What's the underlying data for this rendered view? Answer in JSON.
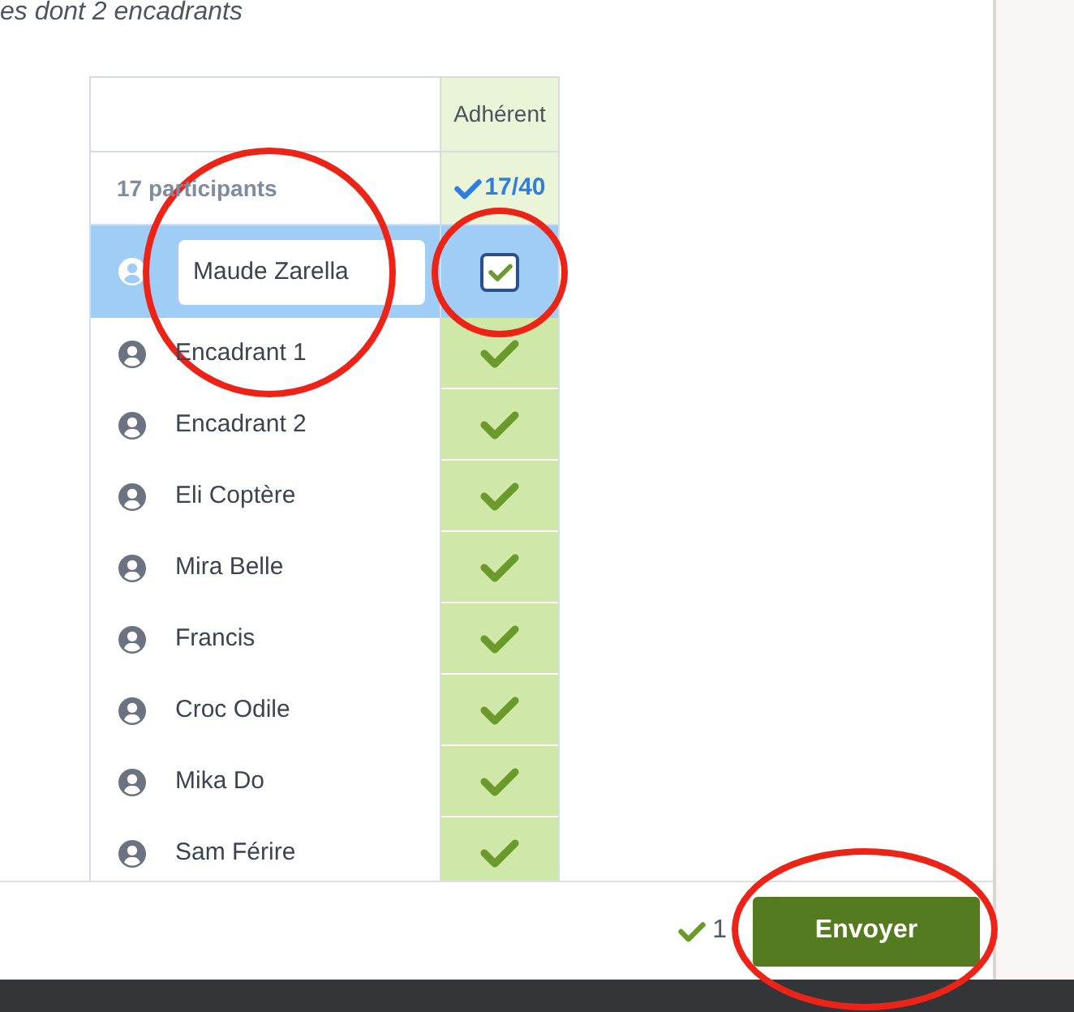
{
  "intro": {
    "text": "es dont 2 encadrants"
  },
  "table": {
    "column_header": "Adhérent",
    "summary": {
      "label": "17 participants",
      "adherent_total": "17/40"
    },
    "rows": [
      {
        "name": "Maude Zarella",
        "selected": true,
        "adherent": true
      },
      {
        "name": "Encadrant 1",
        "selected": false,
        "adherent": true
      },
      {
        "name": "Encadrant 2",
        "selected": false,
        "adherent": true
      },
      {
        "name": "Eli Coptère",
        "selected": false,
        "adherent": true
      },
      {
        "name": "Mira Belle",
        "selected": false,
        "adherent": true
      },
      {
        "name": "Francis",
        "selected": false,
        "adherent": true
      },
      {
        "name": "Croc Odile",
        "selected": false,
        "adherent": true
      },
      {
        "name": "Mika Do",
        "selected": false,
        "adherent": true
      },
      {
        "name": "Sam Férire",
        "selected": false,
        "adherent": true
      }
    ]
  },
  "footer": {
    "selected_count": "1",
    "button": "Envoyer"
  }
}
